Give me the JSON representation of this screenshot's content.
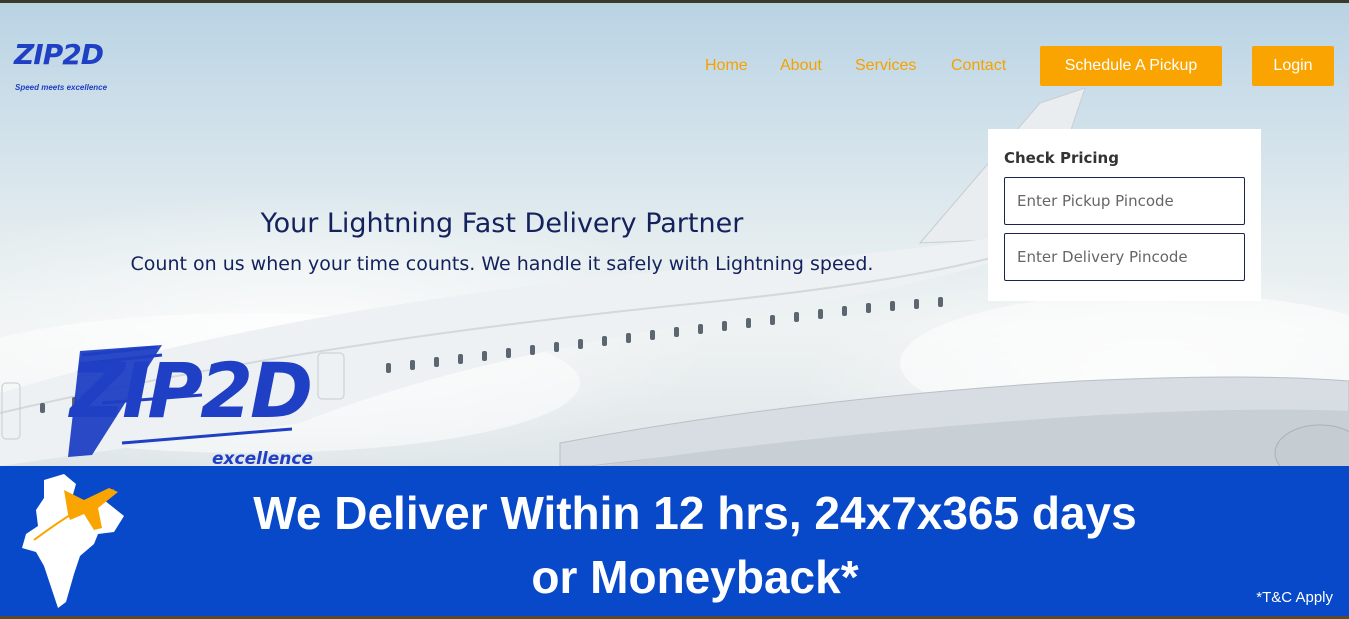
{
  "brand": {
    "logo_text": "ZIP2D",
    "tagline": "Speed meets excellence"
  },
  "nav": {
    "links": [
      {
        "label": "Home"
      },
      {
        "label": "About"
      },
      {
        "label": "Services"
      },
      {
        "label": "Contact"
      }
    ],
    "schedule_label": "Schedule A Pickup",
    "login_label": "Login"
  },
  "hero": {
    "headline": "Your Lightning Fast Delivery Partner",
    "subhead": "Count on us when your time counts. We handle it safely with Lightning speed.",
    "big_logo_text": "ZIP2D",
    "big_logo_tagline": "excellence"
  },
  "pricing": {
    "title": "Check Pricing",
    "pickup_placeholder": "Enter Pickup Pincode",
    "delivery_placeholder": "Enter Delivery Pincode"
  },
  "banner": {
    "line1": "We Deliver Within 12 hrs, 24x7x365 days",
    "line2": "or Moneyback*",
    "tc": "*T&C Apply"
  },
  "colors": {
    "accent": "#f9a400",
    "brand_blue": "#1f3fc4",
    "banner_blue": "#0749c9",
    "headline": "#13215c"
  },
  "icons": [
    "airplane-icon",
    "india-map-icon"
  ]
}
